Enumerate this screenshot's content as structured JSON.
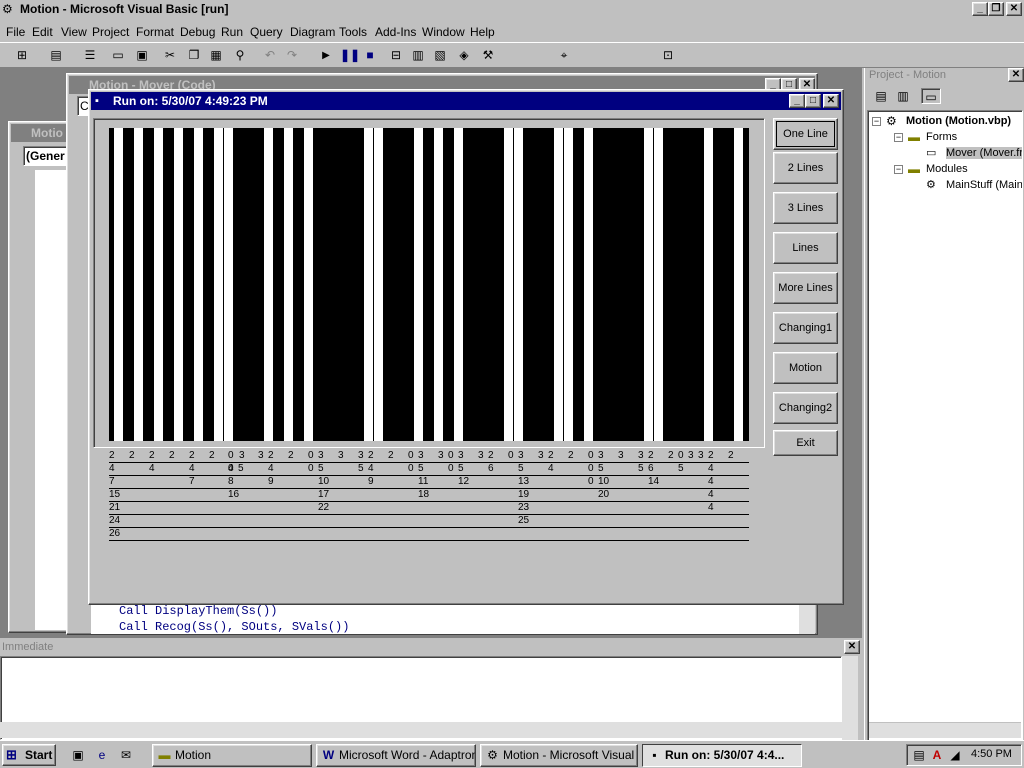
{
  "main_window": {
    "title": "Motion - Microsoft Visual Basic [run]"
  },
  "menu": [
    "File",
    "Edit",
    "View",
    "Project",
    "Format",
    "Debug",
    "Run",
    "Query",
    "Diagram",
    "Tools",
    "Add-Ins",
    "Window",
    "Help"
  ],
  "code_window": {
    "title": "Motion - Mover (Code)",
    "object_combo": "C",
    "lines": [
      "Call DisplayThem(Ss())",
      "Call Recog(Ss(), SOuts, SVals())"
    ]
  },
  "form_window": {
    "title_partial": "Motio",
    "combo": "(Gener"
  },
  "run_window": {
    "title": "Run on: 5/30/07  4:49:23 PM",
    "buttons": [
      "One Line",
      "2 Lines",
      "3 Lines",
      "Lines",
      "More Lines",
      "Changing1",
      "Motion",
      "Changing2",
      "Exit"
    ],
    "stripes": [
      1,
      1,
      1,
      1,
      1,
      1,
      1,
      1,
      1,
      1,
      1,
      1,
      1,
      1,
      0,
      1,
      1,
      1,
      0,
      1,
      1,
      1,
      0,
      1,
      0,
      1,
      1,
      1,
      1,
      1,
      0,
      1,
      1,
      1,
      1,
      1,
      1,
      1,
      1,
      1,
      1,
      1,
      1,
      0,
      1,
      1,
      1,
      1,
      1,
      1,
      1,
      1,
      1,
      1,
      0,
      1,
      1,
      1,
      1,
      1,
      1,
      1,
      1,
      0,
      0,
      0,
      0,
      0,
      0,
      0,
      0,
      0,
      0,
      0,
      0
    ],
    "rows": [
      [
        [
          "2",
          109
        ],
        [
          "2",
          129
        ],
        [
          "2",
          149
        ],
        [
          "2",
          169
        ],
        [
          "2",
          189
        ],
        [
          "2",
          209
        ],
        [
          "0",
          228
        ],
        [
          "3",
          239
        ],
        [
          "3",
          258
        ],
        [
          "2",
          268
        ],
        [
          "2",
          288
        ],
        [
          "0",
          308
        ],
        [
          "3",
          318
        ],
        [
          "3",
          338
        ],
        [
          "3",
          358
        ],
        [
          "2",
          368
        ],
        [
          "2",
          388
        ],
        [
          "0",
          408
        ],
        [
          "3",
          418
        ],
        [
          "3",
          438
        ],
        [
          "0",
          448
        ],
        [
          "3",
          458
        ],
        [
          "3",
          478
        ],
        [
          "2",
          488
        ],
        [
          "0",
          508
        ],
        [
          "3",
          518
        ],
        [
          "3",
          538
        ],
        [
          "2",
          548
        ],
        [
          "2",
          568
        ],
        [
          "0",
          588
        ],
        [
          "3",
          598
        ],
        [
          "3",
          618
        ],
        [
          "3",
          638
        ],
        [
          "2",
          648
        ],
        [
          "2",
          668
        ],
        [
          "0",
          678
        ],
        [
          "3",
          688
        ],
        [
          "3",
          698
        ],
        [
          "2",
          708
        ],
        [
          "2",
          728
        ]
      ],
      [
        [
          "4",
          109
        ],
        [
          "4",
          149
        ],
        [
          "4",
          189
        ],
        [
          "4",
          228
        ],
        [
          "0",
          228
        ],
        [
          "5",
          238
        ],
        [
          "4",
          268
        ],
        [
          "0",
          308
        ],
        [
          "5",
          318
        ],
        [
          "5",
          358
        ],
        [
          "4",
          368
        ],
        [
          "0",
          408
        ],
        [
          "5",
          418
        ],
        [
          "0",
          448
        ],
        [
          "5",
          458
        ],
        [
          "6",
          488
        ],
        [
          "5",
          518
        ],
        [
          "4",
          548
        ],
        [
          "0",
          588
        ],
        [
          "5",
          598
        ],
        [
          "5",
          638
        ],
        [
          "6",
          648
        ],
        [
          "5",
          678
        ],
        [
          "4",
          708
        ]
      ],
      [
        [
          "7",
          109
        ],
        [
          "7",
          189
        ],
        [
          "8",
          228
        ],
        [
          "9",
          268
        ],
        [
          "10",
          318
        ],
        [
          "9",
          368
        ],
        [
          "11",
          418
        ],
        [
          "12",
          458
        ],
        [
          "13",
          518
        ],
        [
          "0",
          588
        ],
        [
          "10",
          598
        ],
        [
          "14",
          648
        ],
        [
          "4",
          708
        ]
      ],
      [
        [
          "15",
          109
        ],
        [
          "16",
          228
        ],
        [
          "17",
          318
        ],
        [
          "18",
          418
        ],
        [
          "19",
          518
        ],
        [
          "20",
          598
        ],
        [
          "4",
          708
        ]
      ],
      [
        [
          "21",
          109
        ],
        [
          "22",
          318
        ],
        [
          "23",
          518
        ],
        [
          "4",
          708
        ]
      ],
      [
        [
          "24",
          109
        ],
        [
          "25",
          518
        ]
      ],
      [
        [
          "26",
          109
        ]
      ]
    ]
  },
  "project_panel": {
    "title": "Project - Motion",
    "root": "Motion (Motion.vbp)",
    "forms_label": "Forms",
    "form_item": "Mover (Mover.frm)",
    "modules_label": "Modules",
    "module_item": "MainStuff (MainStuff.bas)"
  },
  "immediate": {
    "title": "Immediate"
  },
  "taskbar": {
    "start": "Start",
    "tasks": [
      "Motion",
      "Microsoft Word - Adaptron ...",
      "Motion - Microsoft Visual B...",
      "Run on: 5/30/07  4:4..."
    ],
    "clock": "4:50 PM"
  },
  "colors": {
    "titlebar": "#000080",
    "inactive": "#808080",
    "desktop": "#c0c0c0"
  }
}
